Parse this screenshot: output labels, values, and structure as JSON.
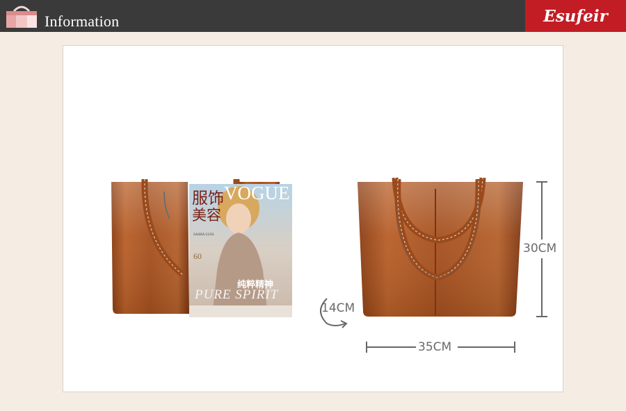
{
  "header": {
    "title": "Information",
    "logo_text": "Esufeir"
  },
  "magazine": {
    "brand": "VOGUE",
    "cn_title_1": "服饰",
    "cn_title_2": "美容",
    "cn_subtitle": "纯粹精神",
    "en_subtitle": "PURE SPIRIT",
    "small_number": "60",
    "small_name": "SASHA LUSS"
  },
  "dimensions": {
    "depth": "14CM",
    "height": "30CM",
    "width": "35CM"
  },
  "colors": {
    "leather": "#a4501f",
    "header_bg": "#3a3a3a",
    "logo_bg": "#c21d24",
    "page_bg": "#f5ede4"
  }
}
